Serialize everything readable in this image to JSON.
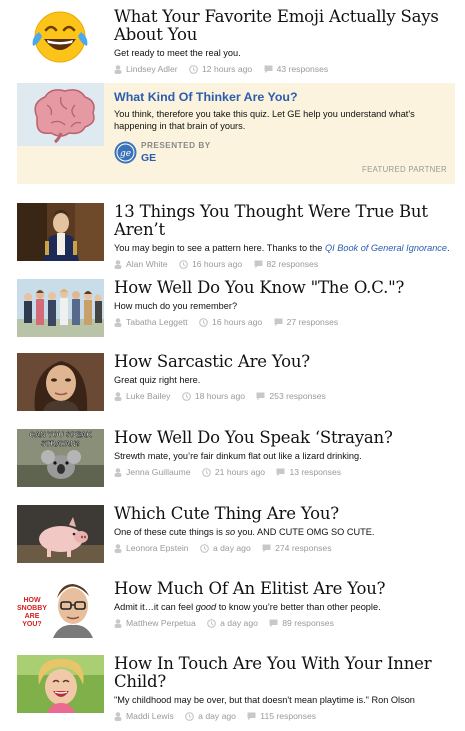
{
  "items": [
    {
      "title": "What Your Favorite Emoji Actually Says About You",
      "description": "Get ready to meet the real you.",
      "author": "Lindsey Adler",
      "time": "12 hours ago",
      "responses": "43 responses",
      "thumb_icon": "laughing-crying-emoji"
    },
    {
      "title": "13 Things You Thought Were True But Aren’t",
      "description_prefix": "You may begin to see a pattern here.",
      "description_mid": " Thanks to the ",
      "description_link": "QI Book of General Ignorance",
      "description_suffix": ".",
      "author": "Alan White",
      "time": "16 hours ago",
      "responses": "82 responses",
      "thumb_icon": "napoleon-portrait"
    },
    {
      "title": "How Well Do You Know \"The O.C.\"?",
      "description": "How much do you remember?",
      "author": "Tabatha Leggett",
      "time": "16 hours ago",
      "responses": "27 responses",
      "thumb_icon": "oc-cast-photo"
    },
    {
      "title": "How Sarcastic Are You?",
      "description": "Great quiz right here.",
      "author": "Luke Bailey",
      "time": "18 hours ago",
      "responses": "253 responses",
      "thumb_icon": "sarcastic-face-photo"
    },
    {
      "title": "How Well Do You Speak ‘Strayan?",
      "description": "Strewth mate, you’re fair dinkum flat out like a lizard drinking.",
      "author": "Jenna Guillaume",
      "time": "21 hours ago",
      "responses": "13 responses",
      "thumb_icon": "koala-photo",
      "thumb_caption": "CAN YOU SPEAK STRAYAN?"
    },
    {
      "title": "Which Cute Thing Are You?",
      "description_prefix": "One of these cute things is ",
      "description_em": "so",
      "description_suffix": " you. AND CUTE OMG SO CUTE.",
      "author": "Leonora Epstein",
      "time": "a day ago",
      "responses": "274 responses",
      "thumb_icon": "piglet-photo"
    },
    {
      "title": "How Much Of An Elitist Are You?",
      "description_prefix": "Admit it…it can feel ",
      "description_em": "good",
      "description_suffix": " to know you’re better than other people.",
      "author": "Matthew Perpetua",
      "time": "a day ago",
      "responses": "89 responses",
      "thumb_icon": "snobby-man-photo",
      "thumb_caption": "HOW SNOBBY ARE YOU?"
    },
    {
      "title": "How In Touch Are You With Your Inner Child?",
      "description_quote": "\"My childhood may be over, but that doesn't mean playtime is.\"",
      "description_attrib": " Ron Olson",
      "author": "Maddi Lewis",
      "time": "a day ago",
      "responses": "115 responses",
      "thumb_icon": "laughing-child-photo"
    }
  ],
  "featured": {
    "title": "What Kind Of Thinker Are You?",
    "description": "You think, therefore you take this quiz. Let GE help you understand what's happening in that brain of yours.",
    "presented_label": "PRESENTED BY",
    "presented_name": "GE",
    "partner_label": "FEATURED PARTNER",
    "thumb_icon": "brain-illustration"
  },
  "colors": {
    "link": "#2a5db0",
    "featured_bg": "#fbf3dd",
    "meta": "#9a9a9a"
  }
}
